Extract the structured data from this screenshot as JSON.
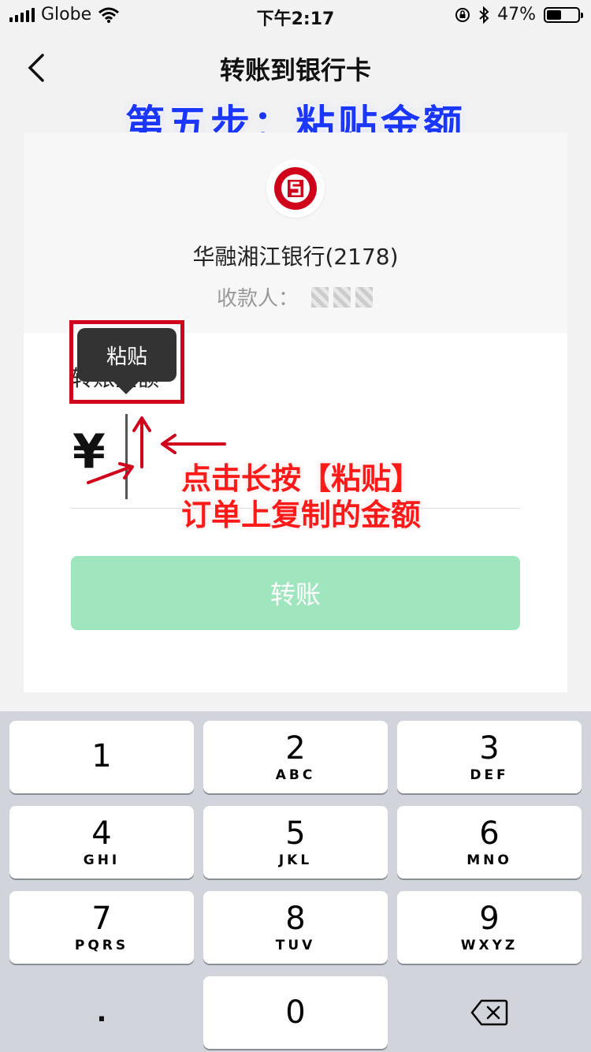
{
  "status_bar": {
    "carrier": "Globe",
    "time": "下午2:17",
    "battery": "47%",
    "battery_level": 0.47
  },
  "nav": {
    "title": "转账到银行卡"
  },
  "annotation_title": "第五步：粘贴金额",
  "bank": {
    "name": "华融湘江银行(2178)",
    "payee_label": "收款人："
  },
  "amount": {
    "label": "转账金额",
    "currency": "¥"
  },
  "paste_tooltip": "粘贴",
  "transfer_button": "转账",
  "annotation_note": {
    "line1": "点击长按【粘贴】",
    "line2": "订单上复制的金额"
  },
  "keypad": [
    {
      "num": "1",
      "letters": ""
    },
    {
      "num": "2",
      "letters": "ABC"
    },
    {
      "num": "3",
      "letters": "DEF"
    },
    {
      "num": "4",
      "letters": "GHI"
    },
    {
      "num": "5",
      "letters": "JKL"
    },
    {
      "num": "6",
      "letters": "MNO"
    },
    {
      "num": "7",
      "letters": "PQRS"
    },
    {
      "num": "8",
      "letters": "TUV"
    },
    {
      "num": "9",
      "letters": "WXYZ"
    },
    {
      "num": "0",
      "letters": ""
    }
  ],
  "keypad_decimal": ".",
  "colors": {
    "brand_green": "#9fe6be",
    "annotation_red": "#ff1a1a",
    "annotation_blue": "#1a36ff",
    "bank_red": "#d0021b"
  }
}
